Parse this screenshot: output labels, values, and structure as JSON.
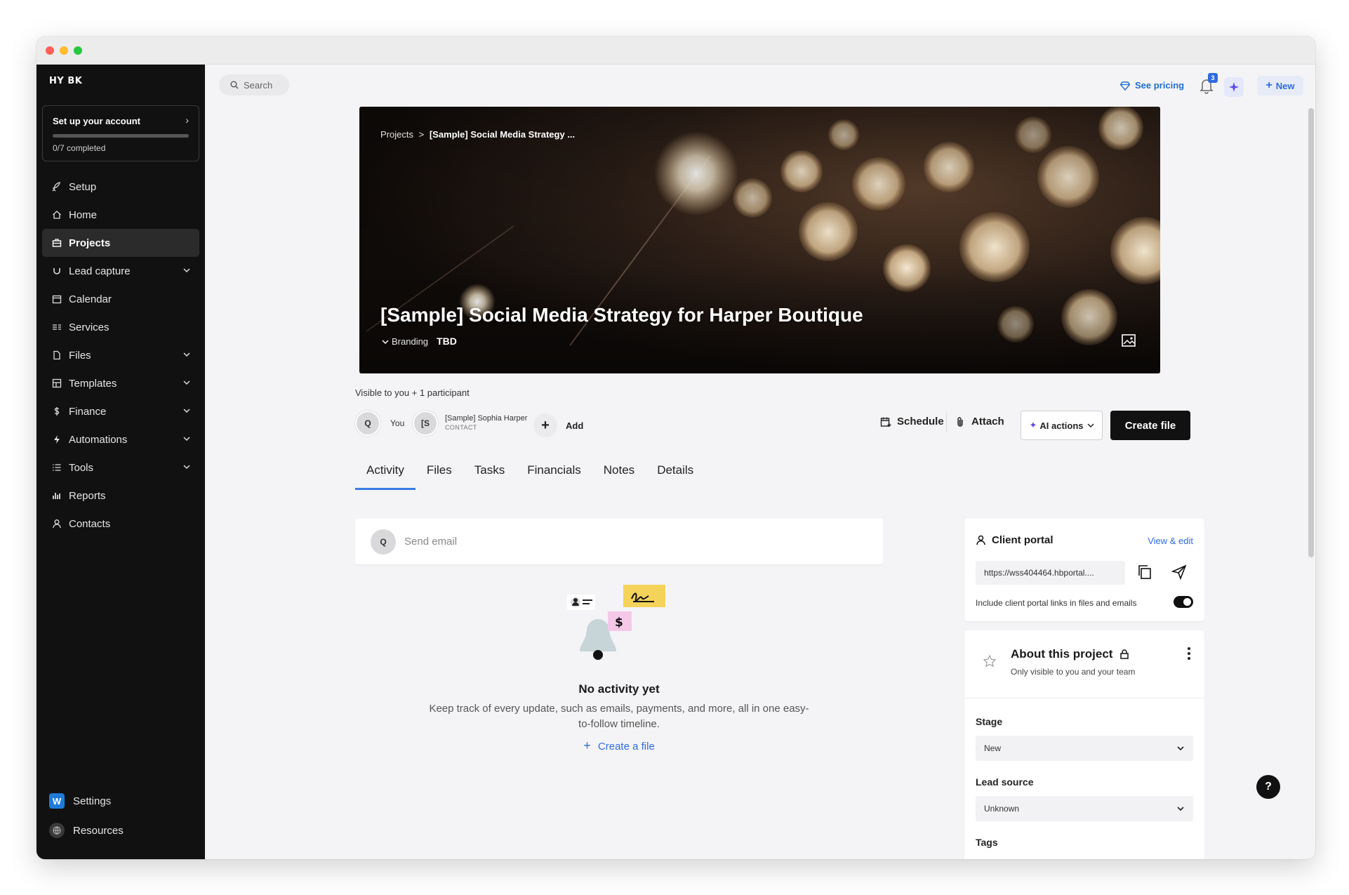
{
  "sidebar": {
    "logo": "HY BK",
    "setup_card": {
      "title": "Set up your account",
      "progress_text": "0/7 completed",
      "progress": 0.0
    },
    "items": [
      {
        "label": "Setup",
        "icon": "rocket-icon"
      },
      {
        "label": "Home",
        "icon": "home-icon"
      },
      {
        "label": "Projects",
        "icon": "briefcase-icon",
        "active": true
      },
      {
        "label": "Lead capture",
        "icon": "magnet-icon",
        "expandable": true
      },
      {
        "label": "Calendar",
        "icon": "calendar-icon"
      },
      {
        "label": "Services",
        "icon": "services-icon"
      },
      {
        "label": "Files",
        "icon": "file-icon",
        "expandable": true
      },
      {
        "label": "Templates",
        "icon": "templates-icon",
        "expandable": true
      },
      {
        "label": "Finance",
        "icon": "dollar-icon",
        "expandable": true
      },
      {
        "label": "Automations",
        "icon": "bolt-icon",
        "expandable": true
      },
      {
        "label": "Tools",
        "icon": "list-icon",
        "expandable": true
      },
      {
        "label": "Reports",
        "icon": "bar-chart-icon"
      },
      {
        "label": "Contacts",
        "icon": "person-icon"
      }
    ],
    "bottom": {
      "settings_badge": "W",
      "settings": "Settings",
      "resources": "Resources"
    }
  },
  "topbar": {
    "search_placeholder": "Search",
    "see_pricing": "See pricing",
    "notification_count": "3",
    "new_label": "New"
  },
  "hero": {
    "breadcrumb_root": "Projects",
    "breadcrumb_sep": ">",
    "breadcrumb_current": "[Sample] Social Media Strategy ...",
    "title": "[Sample] Social Media Strategy for Harper Boutique",
    "type": "Branding",
    "date": "TBD"
  },
  "participants": {
    "visibility": "Visible to you + 1 participant",
    "you_initial": "Q",
    "you_label": "You",
    "contact_initial": "[S",
    "contact_name": "[Sample] Sophia Harper",
    "contact_role": "CONTACT",
    "add_label": "Add"
  },
  "actions": {
    "schedule": "Schedule",
    "attach": "Attach",
    "ai_actions": "AI actions",
    "create_file": "Create file"
  },
  "tabs": [
    "Activity",
    "Files",
    "Tasks",
    "Financials",
    "Notes",
    "Details"
  ],
  "activity": {
    "send_email_initial": "Q",
    "send_email_placeholder": "Send email",
    "empty_title": "No activity yet",
    "empty_desc": "Keep track of every update, such as emails, payments, and more, all in one easy-to-follow timeline.",
    "create_link": "Create a file"
  },
  "client_portal": {
    "title": "Client portal",
    "view_edit": "View & edit",
    "url": "https://wss404464.hbportal....",
    "include_links": "Include client portal links in files and emails",
    "toggle_on": true
  },
  "about": {
    "title": "About this project",
    "subtitle": "Only visible to you and your team",
    "stage_label": "Stage",
    "stage_value": "New",
    "lead_source_label": "Lead source",
    "lead_source_value": "Unknown",
    "tags_label": "Tags"
  },
  "colors": {
    "accent": "#2f6bde",
    "sidebar_bg": "#111111",
    "primary_button": "#111111",
    "ai_purple": "#5b4ee6"
  }
}
